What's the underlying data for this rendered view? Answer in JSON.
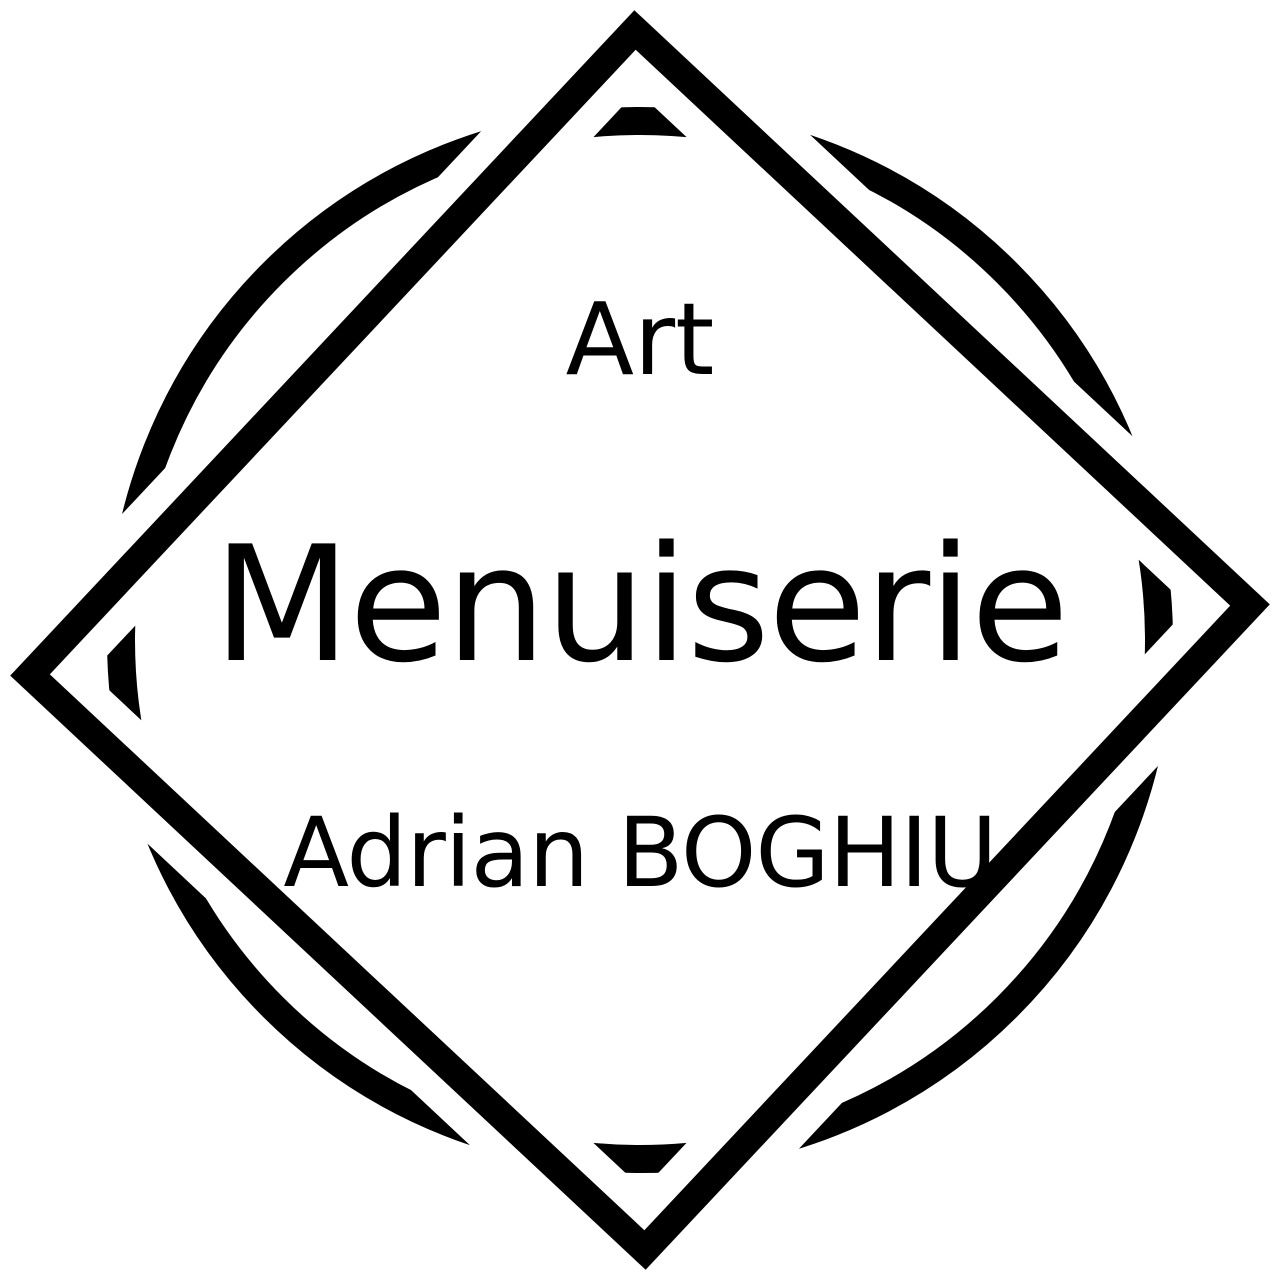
{
  "logo": {
    "line1": "Art",
    "line2": "Menuiserie",
    "line3": "Adrian BOGHIU"
  },
  "colors": {
    "ink": "#000000",
    "background": "#ffffff"
  }
}
